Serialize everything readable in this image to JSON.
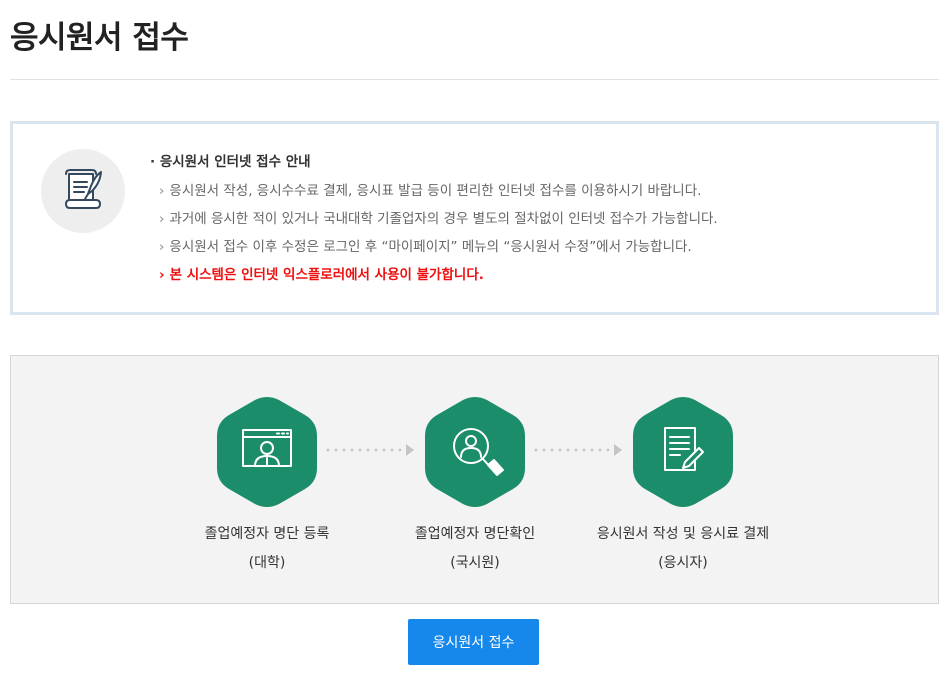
{
  "page": {
    "title": "응시원서 접수"
  },
  "notice": {
    "icon": "document-quill-icon",
    "heading": "· 응시원서 인터넷 접수 안내",
    "lines": [
      "응시원서 작성, 응시수수료 결제, 응시표 발급 등이 편리한 인터넷 접수를 이용하시기 바랍니다.",
      "과거에 응시한 적이 있거나 국내대학 기졸업자의 경우 별도의 절차없이 인터넷 접수가 가능합니다.",
      "응시원서 접수 이후 수정은 로그인 후 “마이페이지” 메뉴의 “응시원서 수정”에서 가능합니다."
    ],
    "warning": "본 시스템은 인터넷 익스플로러에서 사용이 불가합니다.",
    "bullet": "›"
  },
  "process": {
    "steps": [
      {
        "icon": "monitor-person-icon",
        "label": "졸업예정자 명단 등록",
        "sub": "(대학)"
      },
      {
        "icon": "person-search-icon",
        "label": "졸업예정자 명단확인",
        "sub": "(국시원)"
      },
      {
        "icon": "document-pen-icon",
        "label": "응시원서 작성 및 응시료 결제",
        "sub": "(응시자)"
      }
    ]
  },
  "actions": {
    "submit_label": "응시원서 접수"
  },
  "colors": {
    "accent_green": "#1c8d6b",
    "button_blue": "#1788eb",
    "warning_red": "#ee1111",
    "notice_border": "#dbe5f0"
  }
}
